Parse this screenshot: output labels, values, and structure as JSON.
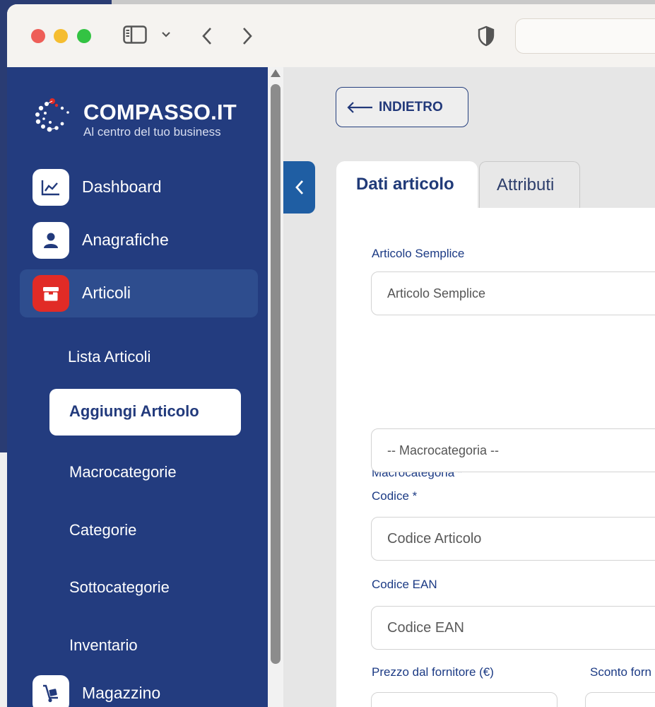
{
  "sidebar": {
    "brand": "COMPASSO.IT",
    "tagline": "Al centro del tuo business",
    "items": [
      {
        "label": "Dashboard",
        "icon": "chart-line-icon"
      },
      {
        "label": "Anagrafiche",
        "icon": "user-icon"
      },
      {
        "label": "Articoli",
        "icon": "box-icon",
        "active": true
      },
      {
        "label": "Magazzino",
        "icon": "hand-truck-icon"
      }
    ],
    "subitems": [
      {
        "label": "Lista Articoli"
      },
      {
        "label": "Aggiungi Articolo",
        "selected": true
      },
      {
        "label": "Macrocategorie"
      },
      {
        "label": "Categorie"
      },
      {
        "label": "Sottocategorie"
      },
      {
        "label": "Inventario"
      }
    ]
  },
  "main": {
    "back_label": "INDIETRO",
    "tabs": [
      {
        "label": "Dati articolo",
        "active": true
      },
      {
        "label": "Attributi",
        "active": false
      }
    ],
    "form": {
      "tipo": {
        "label": "Articolo Semplice",
        "value": "Articolo Semplice"
      },
      "macrocategoria": {
        "label": "Macrocategoria *",
        "value": "-- Macrocategoria --"
      },
      "codice": {
        "label": "Codice *",
        "placeholder": "Codice Articolo"
      },
      "ean": {
        "label": "Codice EAN",
        "placeholder": "Codice EAN"
      },
      "prezzo": {
        "label": "Prezzo dal fornitore (€)",
        "placeholder": ""
      },
      "sconto": {
        "label": "Sconto forn",
        "placeholder": ""
      }
    }
  },
  "colors": {
    "sidebar_bg": "#233c7f",
    "accent_blue": "#1f5ea3",
    "articoli_icon_red": "#e12b26",
    "label_blue": "#1b3a84"
  }
}
